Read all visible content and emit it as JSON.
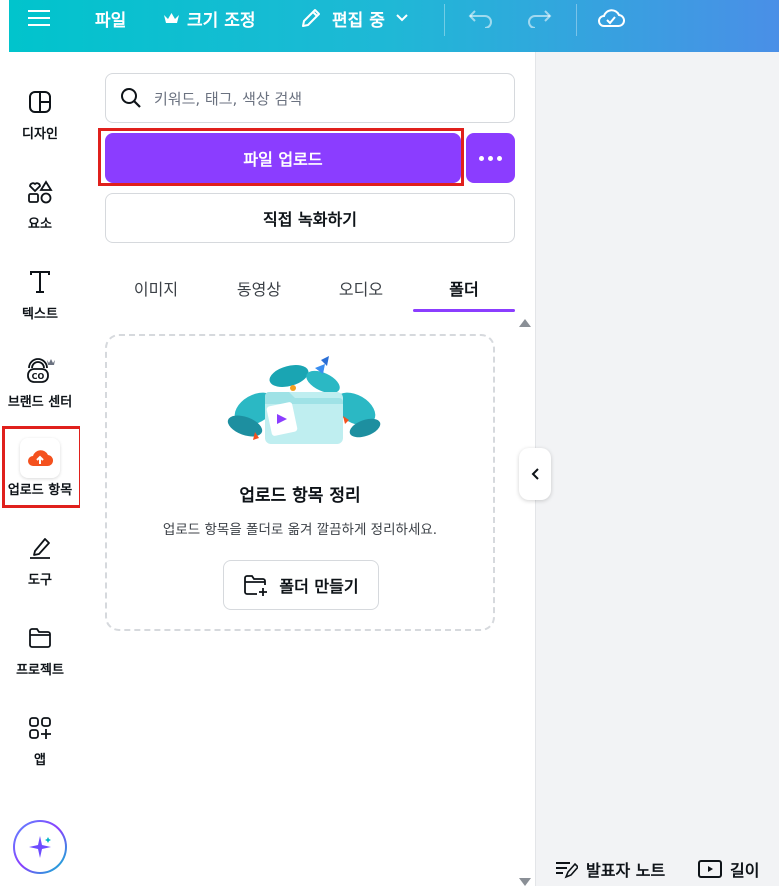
{
  "topbar": {
    "file_label": "파일",
    "resize_label": "크기 조정",
    "edit_mode_label": "편집 중"
  },
  "leftnav": {
    "items": [
      {
        "label": "디자인",
        "icon": "layout-icon"
      },
      {
        "label": "요소",
        "icon": "shapes-icon"
      },
      {
        "label": "텍스트",
        "icon": "text-icon"
      },
      {
        "label": "브랜드 센터",
        "icon": "brand-icon"
      },
      {
        "label": "업로드 항목",
        "icon": "upload-cloud-icon"
      },
      {
        "label": "도구",
        "icon": "draw-icon"
      },
      {
        "label": "프로젝트",
        "icon": "folder-icon"
      },
      {
        "label": "앱",
        "icon": "apps-icon"
      }
    ]
  },
  "panel": {
    "search_placeholder": "키워드, 태그, 색상 검색",
    "upload_button": "파일 업로드",
    "record_button": "직접 녹화하기",
    "tabs": [
      {
        "label": "이미지",
        "active": false
      },
      {
        "label": "동영상",
        "active": false
      },
      {
        "label": "오디오",
        "active": false
      },
      {
        "label": "폴더",
        "active": true
      }
    ],
    "empty_state": {
      "title": "업로드 항목 정리",
      "description": "업로드 항목을 폴더로 옮겨 깔끔하게 정리하세요.",
      "create_folder_button": "폴더 만들기"
    }
  },
  "footer": {
    "notes_label": "발표자 노트",
    "duration_label": "길이"
  },
  "colors": {
    "accent": "#8b3dff",
    "topbar_start": "#00c4cc",
    "topbar_end": "#4a8fe7",
    "highlight": "#e0201c"
  }
}
